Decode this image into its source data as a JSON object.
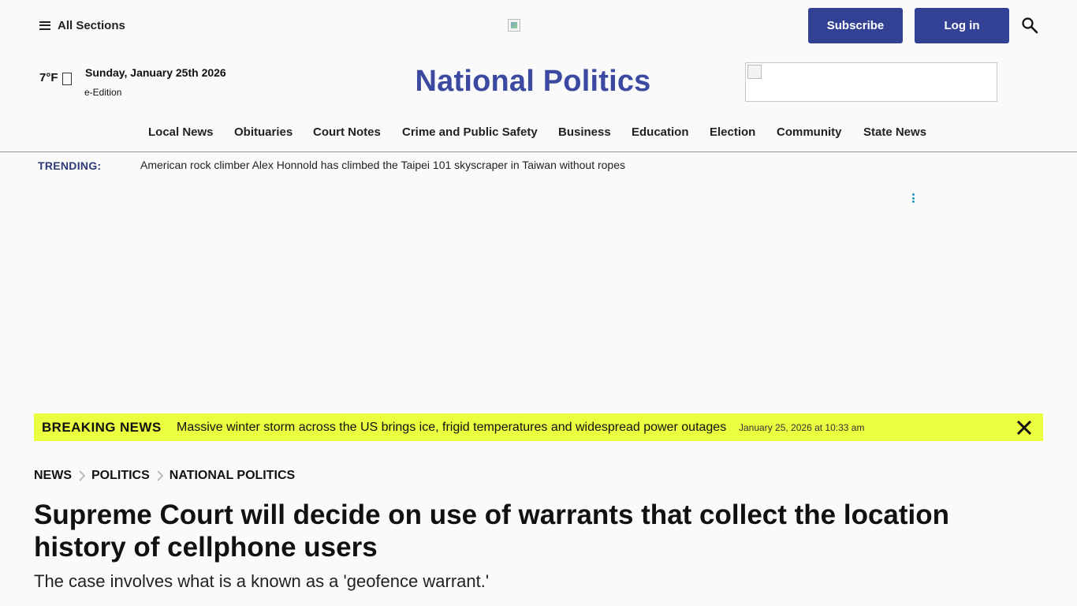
{
  "header": {
    "sections_label": "All Sections",
    "subscribe_label": "Subscribe",
    "login_label": "Log in"
  },
  "masthead": {
    "temperature": "7°F",
    "date": "Sunday, January 25th 2026",
    "eedition_label": "e-Edition",
    "title": "National Politics"
  },
  "nav": {
    "items": [
      {
        "label": "Local News"
      },
      {
        "label": "Obituaries"
      },
      {
        "label": "Court Notes"
      },
      {
        "label": "Crime and Public Safety"
      },
      {
        "label": "Business"
      },
      {
        "label": "Education"
      },
      {
        "label": "Election"
      },
      {
        "label": "Community"
      },
      {
        "label": "State News"
      }
    ]
  },
  "trending": {
    "label": "TRENDING:",
    "text": "American rock climber Alex Honnold has climbed the Taipei 101 skyscraper in Taiwan without ropes"
  },
  "breaking": {
    "label": "BREAKING NEWS",
    "text": "Massive winter storm across the US brings ice, frigid temperatures and widespread power outages",
    "time": "January 25, 2026 at 10:33 am"
  },
  "article": {
    "breadcrumb": [
      "NEWS",
      "POLITICS",
      "NATIONAL POLITICS"
    ],
    "headline": "Supreme Court will decide on use of warrants that collect the location history of cellphone users",
    "subheadline": "The case involves what is a known as a 'geofence warrant.'"
  },
  "colors": {
    "brand": "#334194",
    "title": "#3b4aa0",
    "breaking_bg": "#eaff3f",
    "trending_label": "#2d3a7a"
  },
  "icons": [
    "menu-icon",
    "search-icon",
    "weather-icon",
    "more-vert-icon",
    "close-icon",
    "chevron-right-icon"
  ]
}
